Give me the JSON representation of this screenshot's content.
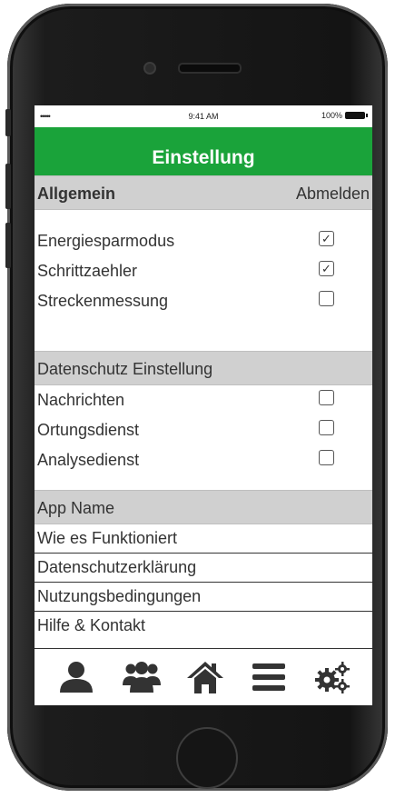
{
  "statusbar": {
    "signal": "•••••",
    "time": "9:41 AM",
    "battery": "100%"
  },
  "header": {
    "title": "Einstellung"
  },
  "general": {
    "title": "Allgemein",
    "logout": "Abmelden",
    "items": [
      {
        "label": "Energiesparmodus",
        "checked": true,
        "mark": "✓"
      },
      {
        "label": "Schrittzaehler",
        "checked": true,
        "mark": "✓"
      },
      {
        "label": "Streckenmessung",
        "checked": false,
        "mark": ""
      }
    ]
  },
  "privacy": {
    "title": "Datenschutz Einstellung",
    "items": [
      {
        "label": "Nachrichten",
        "checked": false,
        "mark": ""
      },
      {
        "label": "Ortungsdienst",
        "checked": false,
        "mark": ""
      },
      {
        "label": "Analysedienst",
        "checked": false,
        "mark": ""
      }
    ]
  },
  "app": {
    "title": "App Name",
    "links": [
      {
        "label": "Wie es Funktioniert"
      },
      {
        "label": "Datenschutzerklärung"
      },
      {
        "label": "Nutzungsbedingungen"
      },
      {
        "label": "Hilfe & Kontakt"
      }
    ]
  },
  "tabbar": {
    "icons": [
      "user-icon",
      "group-icon",
      "home-icon",
      "menu-icon",
      "settings-icon"
    ]
  },
  "colors": {
    "accent": "#1aa33a",
    "section": "#d0d0d0"
  }
}
